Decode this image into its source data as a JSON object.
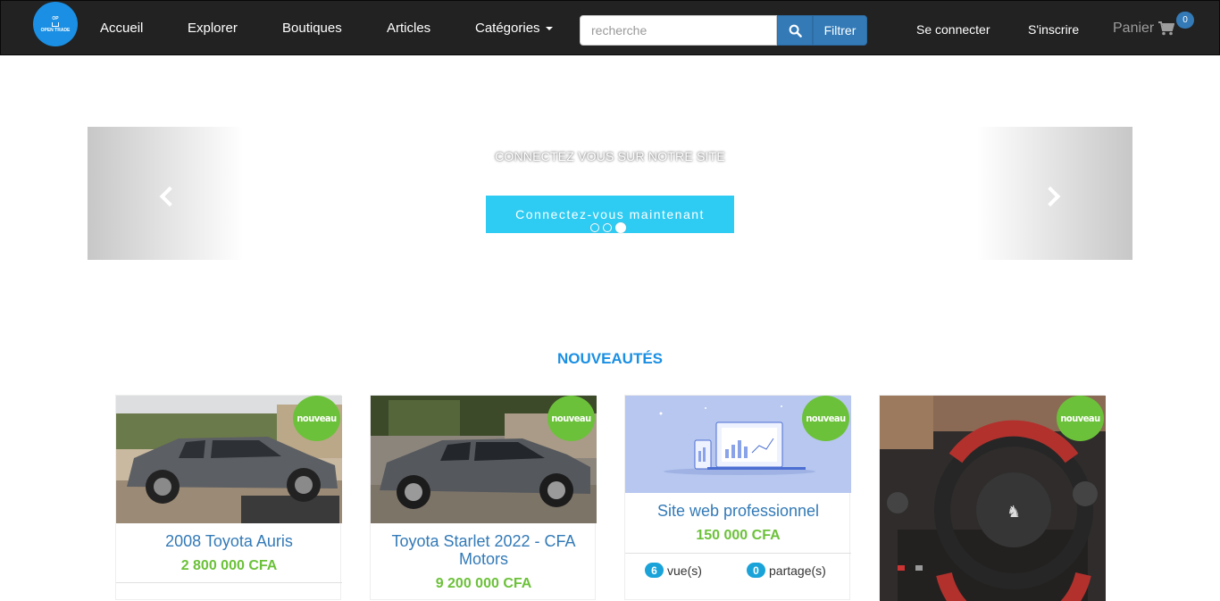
{
  "navbar": {
    "logo_line1": "OP",
    "logo_line2": "OPEN TRADE",
    "links": [
      "Accueil",
      "Explorer",
      "Boutiques",
      "Articles",
      "Catégories"
    ],
    "search_placeholder": "recherche",
    "search_icon": "search-icon",
    "filter_label": "Filtrer",
    "login": "Se connecter",
    "signup": "S'inscrire",
    "cart_label": "Panier",
    "cart_icon": "shopping-cart-icon",
    "cart_count": "0"
  },
  "carousel": {
    "caption": "CONNECTEZ VOUS SUR NOTRE SITE",
    "button": "Connectez-vous maintenant",
    "slide_count": 3,
    "active_slide": 3
  },
  "section": {
    "title": "NOUVEAUTÉS"
  },
  "products": [
    {
      "title": "2008 Toyota Auris",
      "price": "2 800 000 CFA",
      "badge": "nouveau"
    },
    {
      "title": "Toyota Starlet 2022 - CFA Motors",
      "price": "9 200 000 CFA",
      "badge": "nouveau"
    },
    {
      "title": "Site web professionnel",
      "price": "150 000 CFA",
      "badge": "nouveau",
      "views": "6",
      "views_label": "vue(s)",
      "shares": "0",
      "shares_label": "partage(s)"
    },
    {
      "title": "",
      "price": "",
      "badge": "nouveau"
    }
  ],
  "colors": {
    "navbar_bg": "#222222",
    "primary": "#337ab7",
    "accent_blue": "#1a8fe3",
    "cta": "#2ecbf3",
    "green": "#6cc13a"
  }
}
